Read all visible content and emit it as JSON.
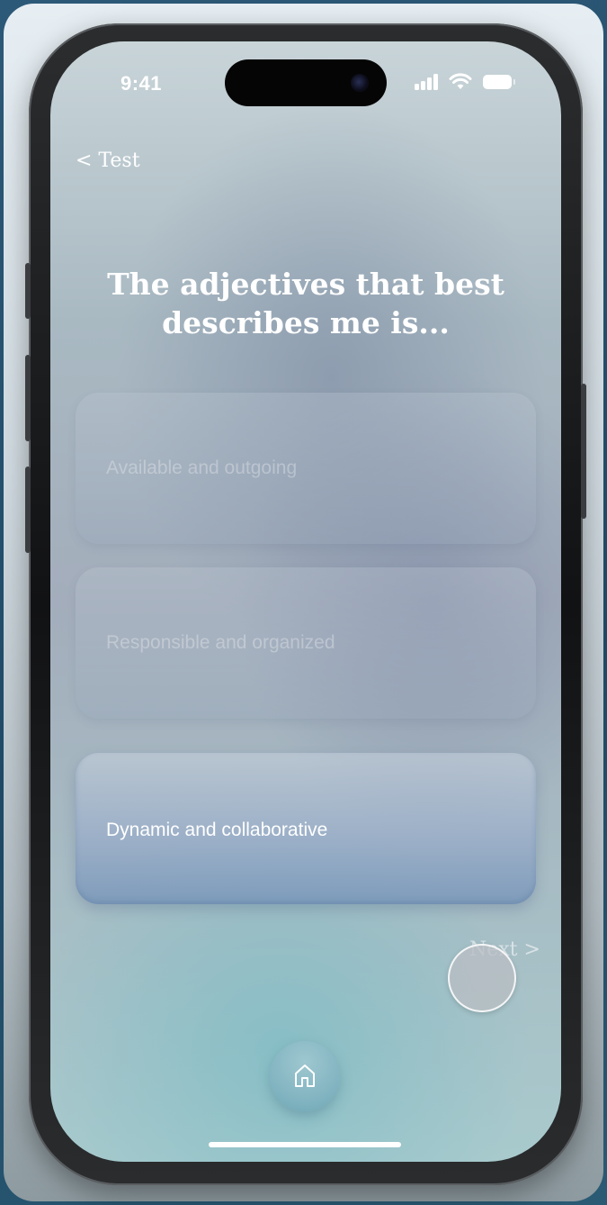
{
  "status_bar": {
    "time": "9:41"
  },
  "nav": {
    "back_label": "< Test"
  },
  "question": {
    "text": "The adjectives that best describes me is..."
  },
  "options": [
    {
      "label": "Available and outgoing",
      "selected": false
    },
    {
      "label": "Responsible and organized",
      "selected": false
    },
    {
      "label": "Dynamic and collaborative",
      "selected": true
    }
  ],
  "actions": {
    "next_label": "Next >"
  },
  "icons": {
    "home": "home-icon",
    "signal": "cellular-signal-icon",
    "wifi": "wifi-icon",
    "battery": "battery-icon"
  },
  "colors": {
    "text_primary": "#ffffff",
    "home_button": "#7fb2bf"
  }
}
